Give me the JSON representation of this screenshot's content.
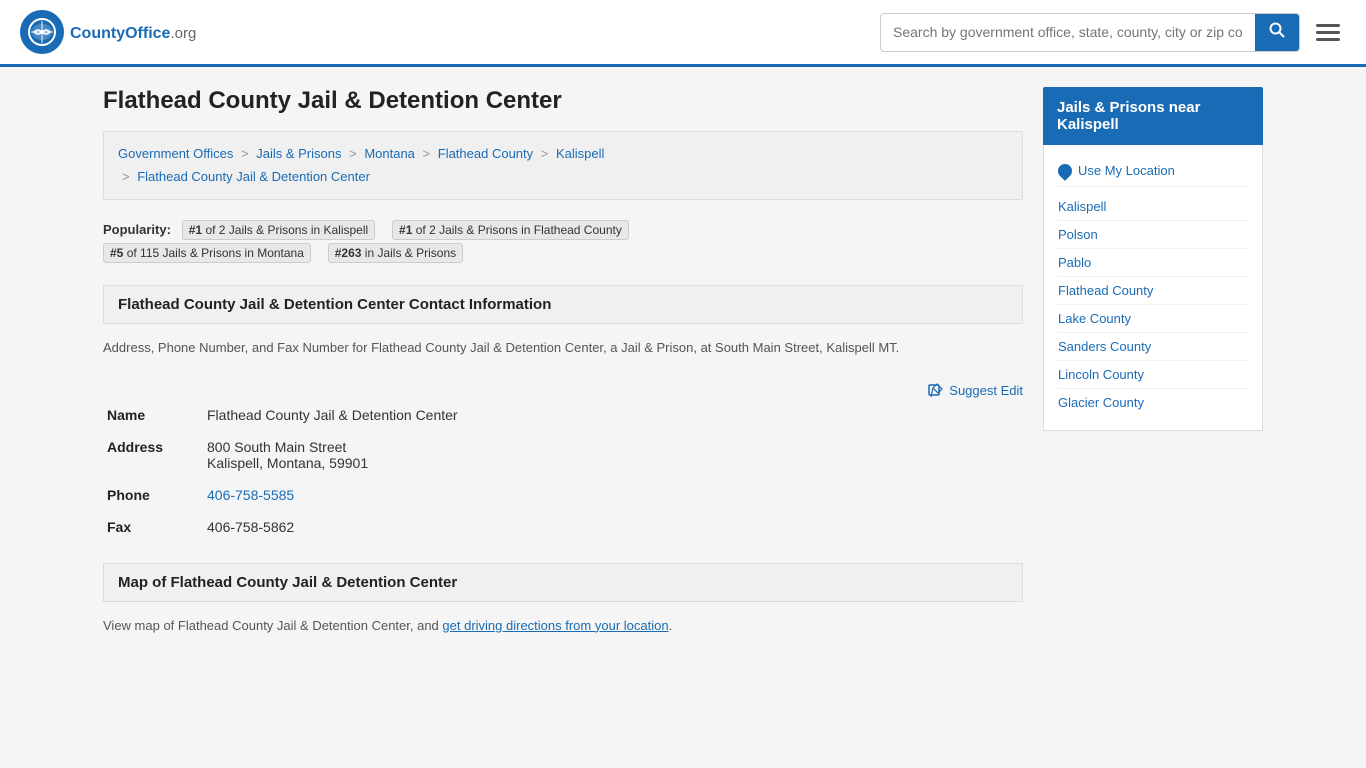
{
  "header": {
    "logo_text": "CountyOffice",
    "logo_suffix": ".org",
    "search_placeholder": "Search by government office, state, county, city or zip code",
    "search_value": ""
  },
  "page": {
    "title": "Flathead County Jail & Detention Center"
  },
  "breadcrumb": {
    "items": [
      {
        "label": "Government Offices",
        "href": "#"
      },
      {
        "label": "Jails & Prisons",
        "href": "#"
      },
      {
        "label": "Montana",
        "href": "#"
      },
      {
        "label": "Flathead County",
        "href": "#"
      },
      {
        "label": "Kalispell",
        "href": "#"
      },
      {
        "label": "Flathead County Jail & Detention Center",
        "href": "#"
      }
    ]
  },
  "popularity": {
    "label": "Popularity:",
    "badges": [
      {
        "text": "#1 of 2 Jails & Prisons in Kalispell"
      },
      {
        "text": "#1 of 2 Jails & Prisons in Flathead County"
      },
      {
        "text": "#5 of 115 Jails & Prisons in Montana"
      },
      {
        "text": "#263 in Jails & Prisons"
      }
    ]
  },
  "contact_section": {
    "heading": "Flathead County Jail & Detention Center Contact Information",
    "description": "Address, Phone Number, and Fax Number for Flathead County Jail & Detention Center, a Jail & Prison, at South Main Street, Kalispell MT.",
    "suggest_edit_label": "Suggest Edit",
    "fields": {
      "name_label": "Name",
      "name_value": "Flathead County Jail & Detention Center",
      "address_label": "Address",
      "address_line1": "800 South Main Street",
      "address_line2": "Kalispell, Montana, 59901",
      "phone_label": "Phone",
      "phone_value": "406-758-5585",
      "fax_label": "Fax",
      "fax_value": "406-758-5862"
    }
  },
  "map_section": {
    "heading": "Map of Flathead County Jail & Detention Center",
    "description_prefix": "View map of Flathead County Jail & Detention Center, and ",
    "directions_link_text": "get driving directions from your location",
    "description_suffix": "."
  },
  "sidebar": {
    "heading_line1": "Jails & Prisons near",
    "heading_line2": "Kalispell",
    "use_location_label": "Use My Location",
    "links": [
      {
        "label": "Kalispell"
      },
      {
        "label": "Polson"
      },
      {
        "label": "Pablo"
      },
      {
        "label": "Flathead County"
      },
      {
        "label": "Lake County"
      },
      {
        "label": "Sanders County"
      },
      {
        "label": "Lincoln County"
      },
      {
        "label": "Glacier County"
      }
    ]
  }
}
